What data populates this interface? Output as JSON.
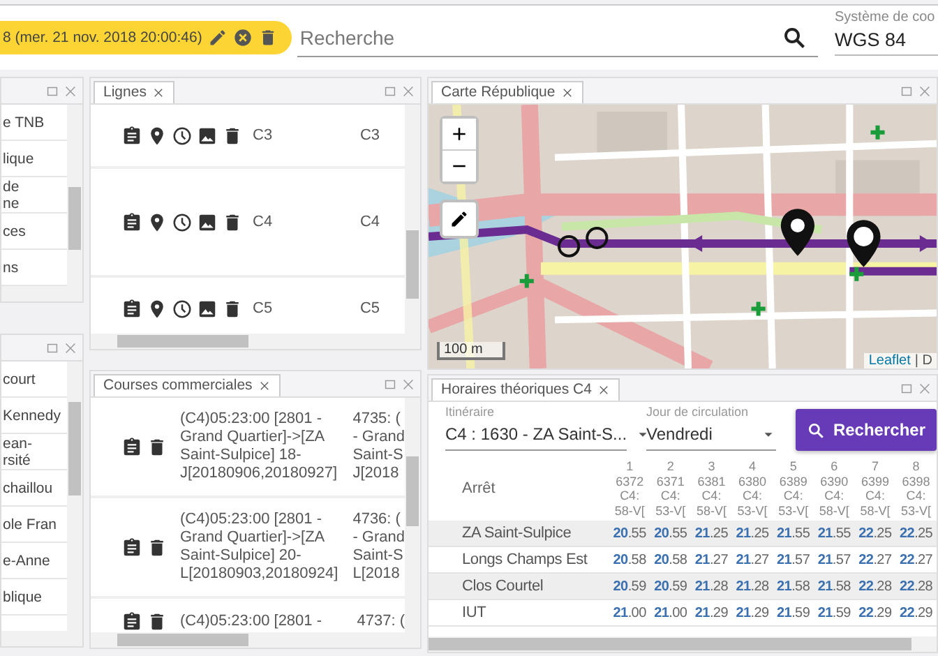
{
  "toolbar": {
    "session_chip": {
      "text": "8 (mer. 21 nov. 2018 20:00:46)"
    },
    "search": {
      "placeholder": "Recherche"
    },
    "coordinate_system": {
      "label": "Système de coo",
      "value": "WGS 84"
    }
  },
  "left_panels": [
    {
      "items": [
        {
          "lines": [
            "e TNB"
          ]
        },
        {
          "lines": [
            "lique"
          ]
        },
        {
          "lines": [
            "de",
            "ne"
          ]
        },
        {
          "lines": [
            "ces"
          ]
        },
        {
          "lines": [
            "ns"
          ]
        }
      ]
    },
    {
      "items": [
        {
          "lines": [
            "court"
          ]
        },
        {
          "lines": [
            "Kennedy"
          ]
        },
        {
          "lines": [
            "ean-",
            "rsité"
          ]
        },
        {
          "lines": [
            "chaillou"
          ]
        },
        {
          "lines": [
            "ole Fran"
          ]
        },
        {
          "lines": [
            "e-Anne"
          ]
        },
        {
          "lines": [
            "blique"
          ]
        }
      ]
    }
  ],
  "lignes": {
    "tab": "Lignes",
    "rows": [
      {
        "name": "C3",
        "code": "C3"
      },
      {
        "name": "C4",
        "code": "C4"
      },
      {
        "name": "C5",
        "code": "C5"
      }
    ]
  },
  "courses": {
    "tab": "Courses commerciales",
    "rows": [
      {
        "description": "(C4)05:23:00 [2801 - Grand Quartier]->[ZA Saint-Sulpice] 18-J[20180906,20180927]",
        "id_lines": [
          "4735: (",
          "- Grand",
          "Saint-S",
          "J[2018"
        ]
      },
      {
        "description": "(C4)05:23:00 [2801 - Grand Quartier]->[ZA Saint-Sulpice] 20-L[20180903,20180924]",
        "id_lines": [
          "4736: (",
          "- Grand",
          "Saint-S",
          "L[2018"
        ]
      },
      {
        "description": "(C4)05:23:00 [2801 -",
        "id_lines": [
          "4737: ("
        ]
      }
    ]
  },
  "map": {
    "tab": "Carte République",
    "zoom_in": "+",
    "zoom_out": "−",
    "scale": "100 m",
    "attribution": {
      "link": "Leaflet",
      "rest": "| D"
    }
  },
  "horaires": {
    "tab": "Horaires théoriques C4",
    "itinerary": {
      "label": "Itinéraire",
      "value": "C4 : 1630 - ZA Saint-S..."
    },
    "day": {
      "label": "Jour de circulation",
      "value": "Vendredi"
    },
    "search_button": "Rechercher",
    "table": {
      "stop_header": "Arrêt",
      "columns": [
        {
          "index": "1",
          "trip": "6372",
          "line": "C4:",
          "code": "58-V["
        },
        {
          "index": "2",
          "trip": "6371",
          "line": "C4:",
          "code": "53-V["
        },
        {
          "index": "3",
          "trip": "6381",
          "line": "C4:",
          "code": "58-V["
        },
        {
          "index": "4",
          "trip": "6380",
          "line": "C4:",
          "code": "53-V["
        },
        {
          "index": "5",
          "trip": "6389",
          "line": "C4:",
          "code": "53-V["
        },
        {
          "index": "6",
          "trip": "6390",
          "line": "C4:",
          "code": "58-V["
        },
        {
          "index": "7",
          "trip": "6399",
          "line": "C4:",
          "code": "58-V["
        },
        {
          "index": "8",
          "trip": "6398",
          "line": "C4:",
          "code": "53-V["
        }
      ],
      "rows": [
        {
          "stop": "ZA Saint-Sulpice",
          "times": [
            "**20**.55",
            "**20**.55",
            "**21**.25",
            "**21**.25",
            "**21**.55",
            "**21**.55",
            "**22**.25",
            "**22**.25"
          ]
        },
        {
          "stop": "Longs Champs Est",
          "times": [
            "**20**.58",
            "**20**.58",
            "**21**.27",
            "**21**.27",
            "**21**.57",
            "**21**.57",
            "**22**.27",
            "**22**.27"
          ]
        },
        {
          "stop": "Clos Courtel",
          "times": [
            "**20**.59",
            "**20**.59",
            "**21**.28",
            "**21**.28",
            "**21**.58",
            "**21**.58",
            "**22**.28",
            "**22**.28"
          ]
        },
        {
          "stop": "IUT",
          "times": [
            "**21**.00",
            "**21**.00",
            "**21**.29",
            "**21**.29",
            "**21**.59",
            "**21**.59",
            "**22**.29",
            "**22**.29"
          ]
        }
      ]
    }
  }
}
